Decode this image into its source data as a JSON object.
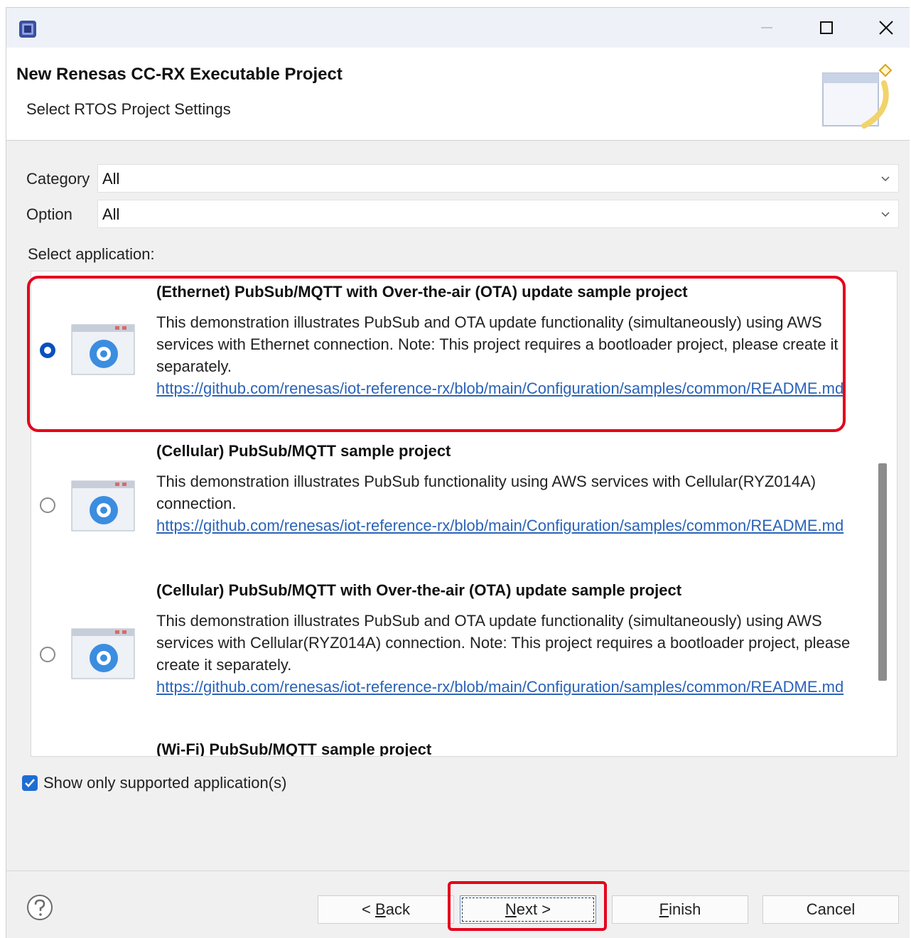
{
  "window": {
    "app_icon": "renesas-ide-icon",
    "controls": {
      "minimize": "minimize-icon",
      "maximize": "maximize-icon",
      "close": "close-icon"
    }
  },
  "header": {
    "title": "New Renesas CC-RX Executable Project",
    "subtitle": "Select RTOS Project Settings",
    "banner_icon": "wizard-banner-icon"
  },
  "filters": {
    "category": {
      "label": "Category",
      "value": "All"
    },
    "option": {
      "label": "Option",
      "value": "All"
    }
  },
  "select_application_label": "Select application:",
  "applications": [
    {
      "title": "(Ethernet) PubSub/MQTT with Over-the-air (OTA) update sample project",
      "description": "This demonstration illustrates PubSub and OTA update functionality (simultaneously) using AWS services with Ethernet connection. Note: This project requires a bootloader project, please create it separately.",
      "link": "https://github.com/renesas/iot-reference-rx/blob/main/Configuration/samples/common/README.md",
      "selected": true
    },
    {
      "title": "(Cellular) PubSub/MQTT sample project",
      "description": "This demonstration illustrates PubSub functionality using AWS services with Cellular(RYZ014A) connection.",
      "link": "https://github.com/renesas/iot-reference-rx/blob/main/Configuration/samples/common/README.md",
      "selected": false
    },
    {
      "title": "(Cellular) PubSub/MQTT with Over-the-air (OTA) update sample project",
      "description": "This demonstration illustrates PubSub and OTA update functionality (simultaneously) using AWS services with Cellular(RYZ014A) connection. Note: This project requires a bootloader project, please create it separately.",
      "link": "https://github.com/renesas/iot-reference-rx/blob/main/Configuration/samples/common/README.md",
      "selected": false
    },
    {
      "title": "(Wi-Fi) PubSub/MQTT sample project"
    }
  ],
  "show_supported": {
    "label": "Show only supported application(s)",
    "checked": true
  },
  "footer": {
    "help_icon": "help-icon",
    "back": {
      "prefix": "< ",
      "mnemonic": "B",
      "rest": "ack"
    },
    "next": {
      "mnemonic": "N",
      "rest": "ext >"
    },
    "finish": {
      "mnemonic": "F",
      "rest": "inish"
    },
    "cancel": "Cancel"
  },
  "colors": {
    "accent": "#0a4fbf",
    "link": "#2a63b8",
    "highlight": "#e4001b",
    "checkbox": "#1f6dd4"
  }
}
